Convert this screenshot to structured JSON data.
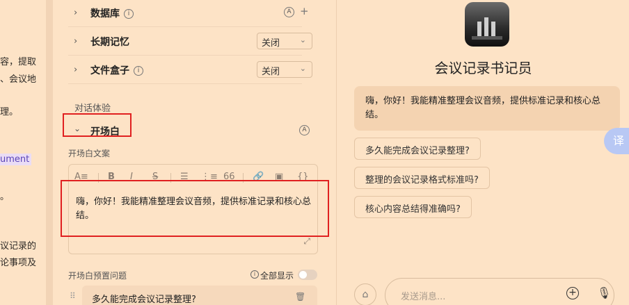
{
  "prompt_panel": {
    "lines": [
      "容，提取",
      "、会议地",
      "理。",
      "ument",
      "。",
      "议记录的",
      "论事项及"
    ]
  },
  "config": {
    "database": {
      "label": "数据库",
      "info": "i",
      "auto": "A",
      "add": "+"
    },
    "long_memory": {
      "label": "长期记忆",
      "value": "关闭"
    },
    "file_box": {
      "label": "文件盒子",
      "info": "i",
      "value": "关闭"
    },
    "section_title": "对话体验",
    "opening": {
      "label": "开场白",
      "auto": "A"
    },
    "opening_text_label": "开场白文案",
    "toolbar": [
      "A≡",
      "B",
      "I",
      "S",
      "☰",
      "⋮≡",
      "66",
      "🔗",
      "▣",
      "{}"
    ],
    "opening_text": "嗨，你好！我能精准整理会议音频，提供标准记录和核心总结。",
    "preset_label": "开场白预置问题",
    "show_all_info": "i",
    "show_all": "全部显示",
    "preset_first": "多久能完成会议记录整理?",
    "drag": "⠿",
    "delete": "🗑"
  },
  "preview": {
    "bot_name": "会议记录书记员",
    "greeting": "嗨，你好！我能精准整理会议音频，提供标准记录和核心总结。",
    "suggestions": [
      "多久能完成会议记录整理?",
      "整理的会议记录格式标准吗?",
      "核心内容总结得准确吗?"
    ],
    "translate": "译",
    "input_placeholder": "发送消息...",
    "plus_label": "+",
    "mic_label": "🎙",
    "attach_label": "⌂"
  }
}
